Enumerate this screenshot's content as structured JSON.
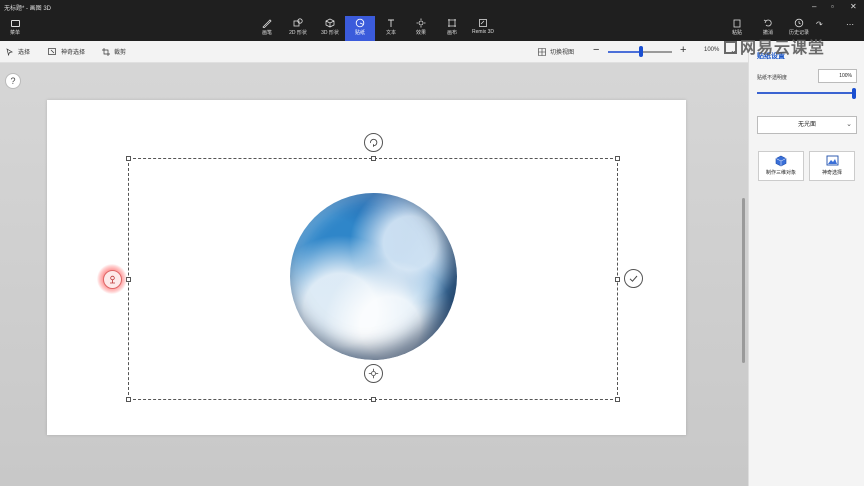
{
  "app": {
    "title": "无标题* - 画图 3D"
  },
  "menu": {
    "label": "菜单"
  },
  "ribbon": {
    "tools": [
      {
        "id": "brush",
        "label": "画笔"
      },
      {
        "id": "shapes2d",
        "label": "2D 形状"
      },
      {
        "id": "shapes3d",
        "label": "3D 形状"
      },
      {
        "id": "stickers",
        "label": "贴纸",
        "active": true
      },
      {
        "id": "text",
        "label": "文本"
      },
      {
        "id": "effects",
        "label": "效果"
      },
      {
        "id": "canvas",
        "label": "画布"
      },
      {
        "id": "remix",
        "label": "Remix 3D"
      }
    ],
    "right": [
      {
        "id": "paste",
        "label": "粘贴"
      },
      {
        "id": "undo",
        "label": "撤消"
      },
      {
        "id": "history",
        "label": "历史记录"
      }
    ]
  },
  "subbar": {
    "select": "选择",
    "magic_select": "神奇选择",
    "crop": "裁剪",
    "switch_view": "切换视图",
    "zoom": "100%",
    "zoom_level": 0.48
  },
  "help": {
    "label": "?"
  },
  "panel": {
    "title": "贴纸设置",
    "opacity_label": "贴纸不透明度",
    "opacity_value": "100%",
    "opacity_level": 1.0,
    "finish_select": "无光面",
    "make3d_label": "制作三维对象",
    "magic_select_label": "神奇选择"
  },
  "watermark": {
    "text": "网易云课堂"
  },
  "colors": {
    "accent": "#3b5bdb",
    "titlebar": "#1f1f1f",
    "panel_title": "#1a56c8"
  }
}
